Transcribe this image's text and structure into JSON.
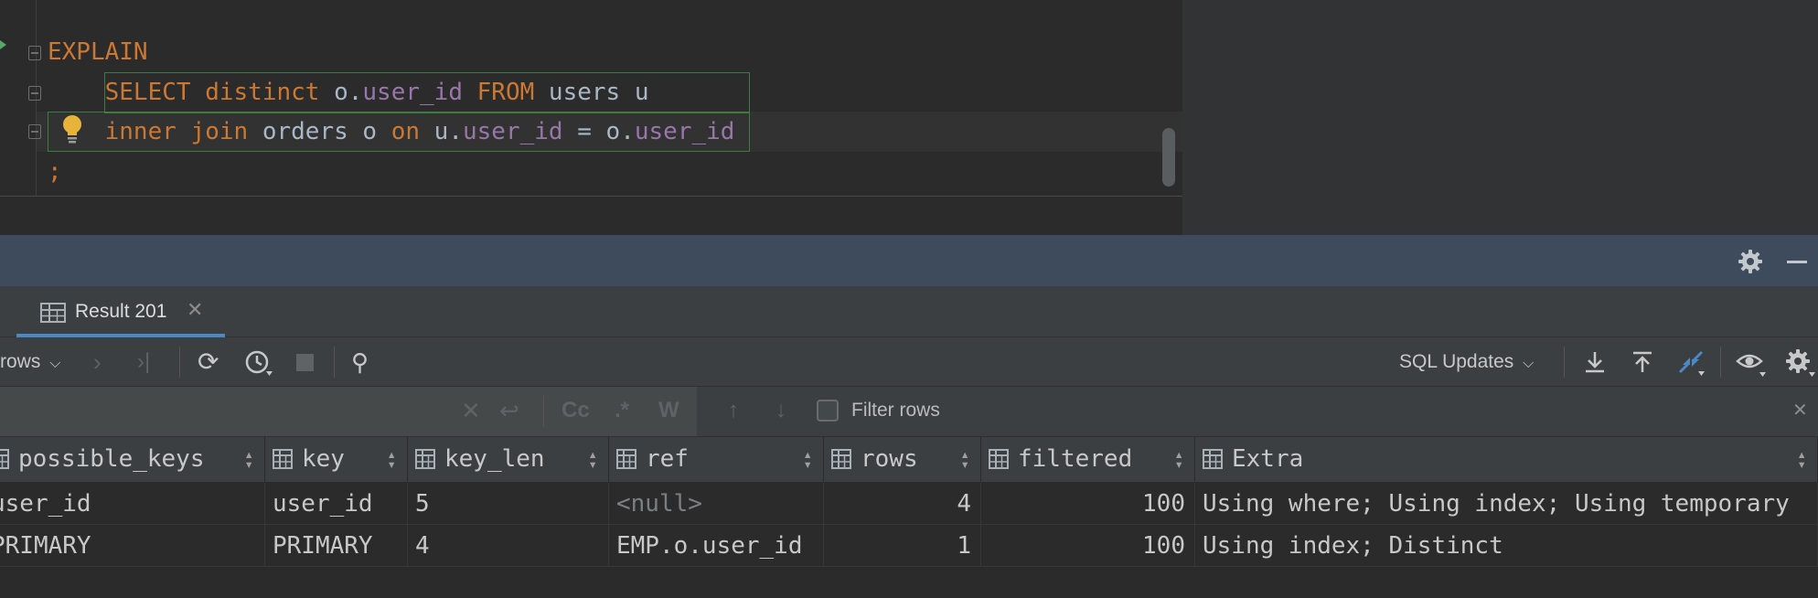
{
  "editor": {
    "lines": [
      [
        {
          "t": "EXPLAIN",
          "c": "kw"
        }
      ],
      [
        {
          "t": "    ",
          "c": "pl"
        },
        {
          "t": "SELECT",
          "c": "kw"
        },
        {
          "t": " ",
          "c": "pl"
        },
        {
          "t": "distinct",
          "c": "kw"
        },
        {
          "t": " o.",
          "c": "pl"
        },
        {
          "t": "user_id",
          "c": "fld"
        },
        {
          "t": " ",
          "c": "pl"
        },
        {
          "t": "FROM",
          "c": "kw"
        },
        {
          "t": " users u",
          "c": "pl"
        }
      ],
      [
        {
          "t": "    ",
          "c": "pl"
        },
        {
          "t": "inner join",
          "c": "kw"
        },
        {
          "t": " orders o ",
          "c": "pl"
        },
        {
          "t": "on",
          "c": "kw"
        },
        {
          "t": " u.",
          "c": "pl"
        },
        {
          "t": "user_id",
          "c": "fld"
        },
        {
          "t": " = o.",
          "c": "pl"
        },
        {
          "t": "user_id",
          "c": "fld"
        }
      ],
      [
        {
          "t": ";",
          "c": "kw"
        }
      ]
    ],
    "colors": {
      "keyword": "#cc7832",
      "field": "#9876aa",
      "plain": "#a9b7c6"
    }
  },
  "tool_window": {
    "settings_icon": "gear-icon",
    "minimize_icon": "minimize-icon"
  },
  "tabs": [
    {
      "label": "Result 201",
      "icon": "table-icon",
      "close_icon": "close-icon",
      "active": true
    }
  ],
  "toolbar": {
    "rows_label": "rows",
    "rows_dropdown_icon": "chevron-down-icon",
    "sql_updates_label": "SQL Updates",
    "icons": [
      "next-page-icon",
      "last-page-icon",
      "refresh-icon",
      "history-icon",
      "stop-icon",
      "pin-icon",
      "export-icon",
      "import-icon",
      "compare-icon",
      "view-icon",
      "gear-icon"
    ]
  },
  "filter_bar": {
    "filter_label": "Filter rows",
    "match_case_label": "Cc",
    "regex_label": ".*",
    "words_label": "W"
  },
  "grid": {
    "columns": [
      "possible_keys",
      "key",
      "key_len",
      "ref",
      "rows",
      "filtered",
      "Extra"
    ],
    "rows": [
      [
        "user_id",
        "user_id",
        "5",
        "<null>",
        "4",
        "100",
        "Using where; Using index; Using temporary"
      ],
      [
        "PRIMARY",
        "PRIMARY",
        "4",
        "EMP.o.user_id",
        "1",
        "100",
        "Using index; Distinct"
      ]
    ],
    "null_color": "#7c7f82"
  }
}
